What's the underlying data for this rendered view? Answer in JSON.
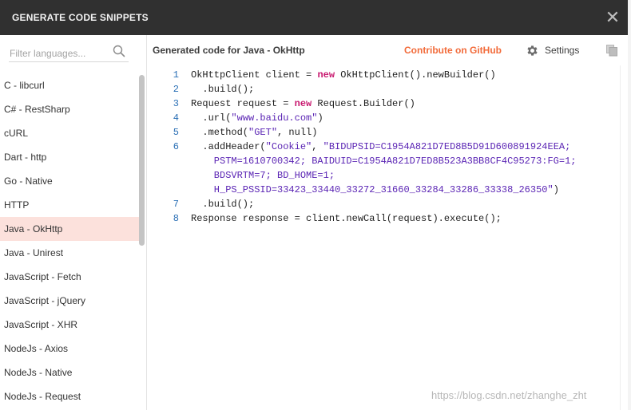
{
  "modal": {
    "title": "GENERATE CODE SNIPPETS"
  },
  "sidebar": {
    "filter_placeholder": "Filter languages...",
    "active_index": 9,
    "items": [
      {
        "label": "C - libcurl"
      },
      {
        "label": "C# - RestSharp"
      },
      {
        "label": "cURL"
      },
      {
        "label": "Dart - http"
      },
      {
        "label": "Go - Native"
      },
      {
        "label": "HTTP"
      },
      {
        "label": "Java - OkHttp"
      },
      {
        "label": "Java - Unirest"
      },
      {
        "label": "JavaScript - Fetch"
      },
      {
        "label": "JavaScript - jQuery"
      },
      {
        "label": "JavaScript - XHR"
      },
      {
        "label": "NodeJs - Axios"
      },
      {
        "label": "NodeJs - Native"
      },
      {
        "label": "NodeJs - Request"
      }
    ]
  },
  "content": {
    "title": "Generated code for Java - OkHttp",
    "contribute_label": "Contribute on GitHub",
    "settings_label": "Settings",
    "gutter": [
      "1",
      "2",
      "3",
      "4",
      "5",
      "6",
      "",
      "",
      "",
      "7",
      "8"
    ],
    "code": {
      "l1_a": "OkHttpClient client = ",
      "l1_kw": "new",
      "l1_b": " OkHttpClient().newBuilder()",
      "l2": "  .build();",
      "l3_a": "Request request = ",
      "l3_kw": "new",
      "l3_b": " Request.Builder()",
      "l4_a": "  .url(",
      "l4_str": "\"www.baidu.com\"",
      "l4_b": ")",
      "l5_a": "  .method(",
      "l5_str": "\"GET\"",
      "l5_b": ", null)",
      "l6_a": "  .addHeader(",
      "l6_str1": "\"Cookie\"",
      "l6_b": ", ",
      "l6_str2": "\"BIDUPSID=C1954A821D7ED8B5D91D600891924EEA;",
      "l6_w1": "    PSTM=1610700342; BAIDUID=C1954A821D7ED8B523A3BB8CF4C95273:FG=1;",
      "l6_w2": "    BDSVRTM=7; BD_HOME=1;",
      "l6_w3": "    H_PS_PSSID=33423_33440_33272_31660_33284_33286_33338_26350\"",
      "l6_end": ")",
      "l7": "  .build();",
      "l8": "Response response = client.newCall(request).execute();"
    }
  },
  "watermark": "https://blog.csdn.net/zhanghe_zht",
  "icons": {
    "close": "close-icon",
    "search": "search-icon",
    "settings": "gear-icon",
    "copy": "copy-icon"
  },
  "colors": {
    "titlebar": "#303030",
    "accent": "#f26b3a",
    "active_item_bg": "#fce1dc",
    "keyword": "#c8196f",
    "string": "#5a24b4",
    "line_number": "#2a6fb5"
  }
}
